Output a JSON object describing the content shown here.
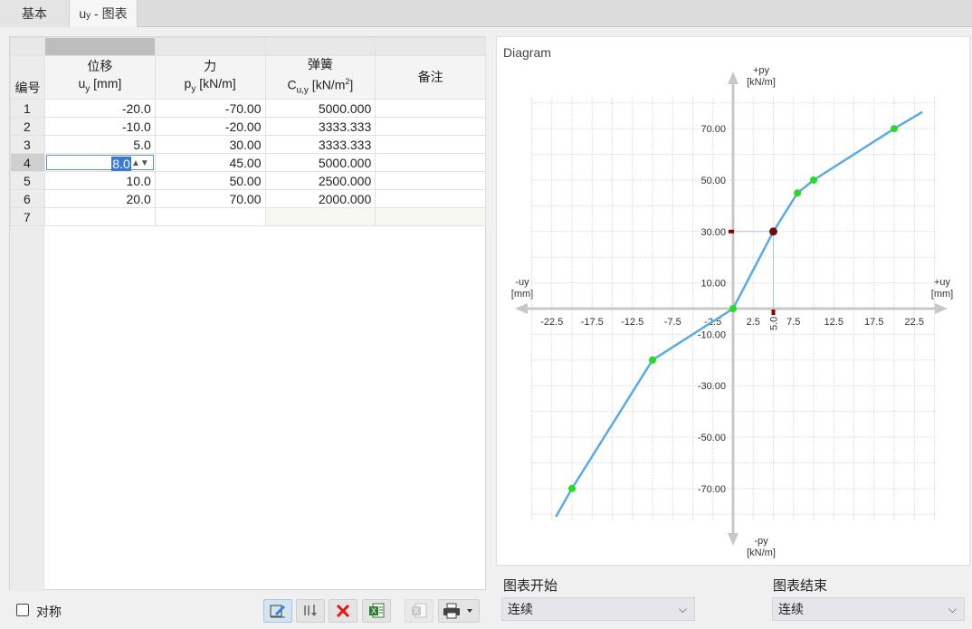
{
  "tabs": [
    {
      "label": "基本"
    },
    {
      "label_main": "u",
      "label_sub": "y",
      "label_rest": " - 图表"
    }
  ],
  "table": {
    "columns": [
      {
        "name": "位移",
        "unit_main": "u",
        "unit_sub": "y",
        "unit_rest": " [mm]"
      },
      {
        "name": "力",
        "unit_main": "p",
        "unit_sub": "y",
        "unit_rest": " [kN/m]"
      },
      {
        "name": "弹簧",
        "unit_main": "C",
        "unit_sub": "u,y",
        "unit_rest": " [kN/m",
        "unit_sup": "2",
        "unit_end": "]"
      },
      {
        "name": "备注"
      }
    ],
    "id_header": "编号",
    "rows": [
      {
        "id": "1",
        "u": "-20.0",
        "p": "-70.00",
        "c": "5000.000"
      },
      {
        "id": "2",
        "u": "-10.0",
        "p": "-20.00",
        "c": "3333.333"
      },
      {
        "id": "3",
        "u": "5.0",
        "p": "30.00",
        "c": "3333.333"
      },
      {
        "id": "4",
        "u": "8.0",
        "p": "45.00",
        "c": "5000.000"
      },
      {
        "id": "5",
        "u": "10.0",
        "p": "50.00",
        "c": "2500.000"
      },
      {
        "id": "6",
        "u": "20.0",
        "p": "70.00",
        "c": "2000.000"
      },
      {
        "id": "7",
        "u": "",
        "p": "",
        "c": ""
      }
    ]
  },
  "symmetric_label": "对称",
  "diagram": {
    "title": "Diagram",
    "axis_top": [
      "+py",
      "[kN/m]"
    ],
    "axis_bottom": [
      "-py",
      "[kN/m]"
    ],
    "axis_left": [
      "-uy",
      "[mm]"
    ],
    "axis_right": [
      "+uy",
      "[mm]"
    ],
    "marker_x_label": "5.0"
  },
  "chart_data": {
    "type": "line",
    "x": [
      -20.0,
      -10.0,
      0.0,
      5.0,
      8.0,
      10.0,
      20.0
    ],
    "y": [
      -70.0,
      -20.0,
      0.0,
      30.0,
      45.0,
      50.0,
      70.0
    ],
    "extension_start": [
      -22.0,
      -81.0
    ],
    "extension_end": [
      23.5,
      76.5
    ],
    "x_ticks": [
      "-22.5",
      "-17.5",
      "-12.5",
      "-7.5",
      "-2.5",
      "2.5",
      "7.5",
      "12.5",
      "17.5",
      "22.5"
    ],
    "y_ticks": [
      "70.00",
      "50.00",
      "30.00",
      "10.00",
      "-10.00",
      "-30.00",
      "-50.00",
      "-70.00"
    ],
    "xlim": [
      -25,
      25
    ],
    "ylim": [
      -85,
      85
    ],
    "selected_point": [
      5.0,
      30.0
    ],
    "grid": true,
    "colors": {
      "line": "#5aa9e8",
      "point": "#22dd22",
      "selected": "#8a0000"
    }
  },
  "options": {
    "start_label": "图表开始",
    "start_value": "连续",
    "end_label": "图表结束",
    "end_value": "连续"
  }
}
